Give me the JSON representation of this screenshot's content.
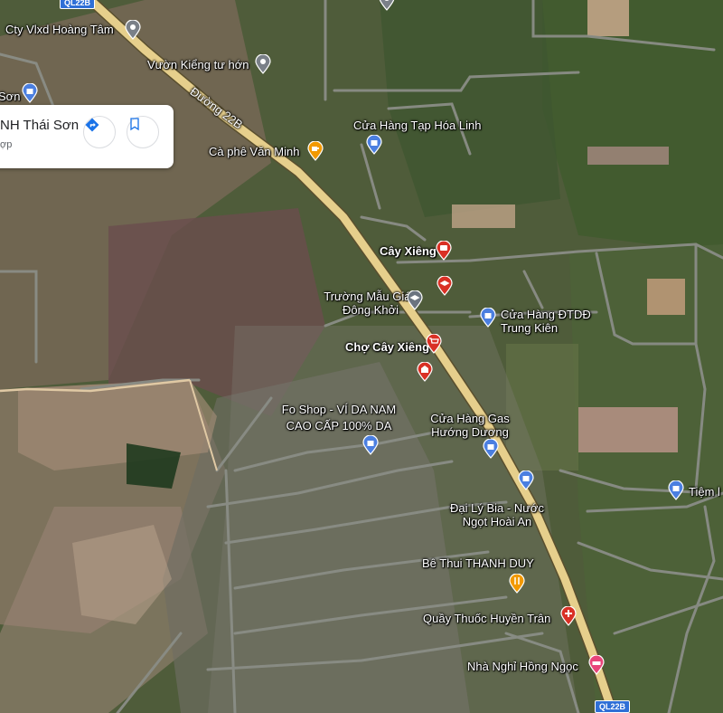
{
  "place_card": {
    "title": "NH Thái Sơn",
    "subtitle": "ợp",
    "directions_icon": "directions-icon",
    "save_icon": "bookmark-icon"
  },
  "roads": {
    "main_road_label": "Đường 22B",
    "shield_top": "QL22B",
    "shield_bottom": "QL22B"
  },
  "places": [
    {
      "name": "Cty Vlxd Hoàng Tâm",
      "icon": "pin-gray"
    },
    {
      "name": "Vườn Kiểng tư hớn",
      "icon": "pin-gray"
    },
    {
      "name": "Cửa Hàng Tạp Hóa Linh",
      "icon": "shopping-bag-icon"
    },
    {
      "name": "Cà phê Văn Minh",
      "icon": "coffee-icon"
    },
    {
      "name": "Cây Xiêng",
      "icon": "bus-icon"
    },
    {
      "name": "Trường Mẫu Giáo Đông Khởi",
      "icon": "school-icon"
    },
    {
      "name": "Cửa Hàng ĐTDĐ Trung Kiên",
      "icon": "shopping-bag-icon"
    },
    {
      "name": "Chợ Cây Xiêng",
      "icon": "cart-icon"
    },
    {
      "name": "Fo Shop - VÍ DA NAM CAO CẤP 100% DA",
      "icon": "shopping-bag-icon"
    },
    {
      "name": "Cửa Hàng Gas Hướng Dương",
      "icon": "shopping-bag-icon"
    },
    {
      "name": "Đại Lý Bia - Nước Ngọt Hoài An",
      "icon": "shopping-bag-icon"
    },
    {
      "name": "Bê Thui THANH DUY",
      "icon": "restaurant-icon"
    },
    {
      "name": "Quầy Thuốc Huyền Trân",
      "icon": "pharmacy-icon"
    },
    {
      "name": "Nhà Nghỉ Hồng Ngọc",
      "icon": "hotel-icon"
    },
    {
      "name": "Tiệm l",
      "icon": "shopping-bag-icon"
    },
    {
      "name": "Sơn",
      "icon": "shopping-bag-icon"
    }
  ],
  "colors": {
    "main_road": "#e6cf8c",
    "local_road": "#8a8d86",
    "shop_pin": "#4b7fe0",
    "food_pin": "#f29900",
    "red_pin": "#d93025",
    "hotel_pin": "#e8457a",
    "school_pin": "#6b7480"
  }
}
